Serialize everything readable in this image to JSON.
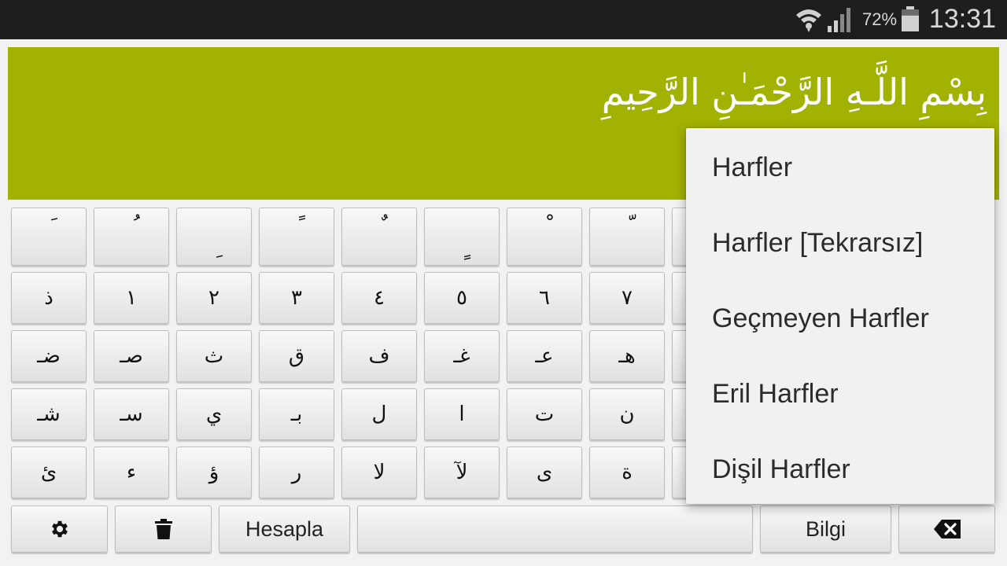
{
  "status_bar": {
    "time": "13:31",
    "battery_percent": "72%",
    "battery_level": 0.72,
    "icons": [
      "wifi-icon",
      "signal-icon",
      "battery-icon"
    ]
  },
  "display": {
    "text": "بِسْمِ اللَّـهِ الرَّحْمَـٰنِ الرَّحِيمِ",
    "background_color": "#a2b200"
  },
  "keyboard": {
    "harakat_row": [
      "َ",
      "ُ",
      "ِ",
      "ً",
      "ٌ",
      "ٍ",
      "ْ",
      "ّ"
    ],
    "row1": [
      "ذ",
      "١",
      "٢",
      "٣",
      "٤",
      "٥",
      "٦",
      "٧"
    ],
    "row2": [
      "ضـ",
      "صـ",
      "ث",
      "ق",
      "ف",
      "غـ",
      "عـ",
      "هـ"
    ],
    "row3": [
      "شـ",
      "سـ",
      "ي",
      "بـ",
      "ل",
      "ا",
      "ت",
      "ن"
    ],
    "row4": [
      "ئ",
      "ء",
      "ؤ",
      "ر",
      "لا",
      "لآ",
      "ى",
      "ة"
    ],
    "bottom": {
      "settings_icon": "gear-icon",
      "delete_icon": "trash-icon",
      "calculate_label": "Hesapla",
      "space_label": "",
      "info_label": "Bilgi",
      "backspace_icon": "backspace-icon"
    }
  },
  "menu": {
    "items": [
      "Harfler",
      "Harfler [Tekrarsız]",
      "Geçmeyen Harfler",
      "Eril Harfler",
      "Dişil Harfler"
    ]
  }
}
